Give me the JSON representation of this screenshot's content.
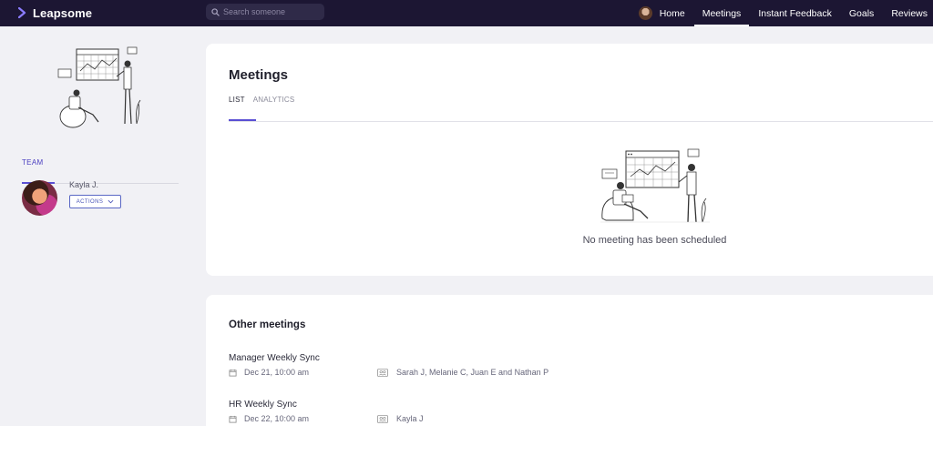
{
  "brand": {
    "name": "Leapsome",
    "accent": "#5a4fd3"
  },
  "search": {
    "placeholder": "Search someone"
  },
  "nav": {
    "items": [
      {
        "label": "Home"
      },
      {
        "label": "Meetings"
      },
      {
        "label": "Instant Feedback"
      },
      {
        "label": "Goals"
      },
      {
        "label": "Reviews"
      }
    ],
    "active": "Meetings"
  },
  "sidebar": {
    "tab": "TEAM",
    "members": [
      {
        "name": "Kayla J.",
        "actions_label": "ACTIONS"
      }
    ]
  },
  "meetings": {
    "title": "Meetings",
    "tabs": [
      "LIST",
      "ANALYTICS"
    ],
    "active_tab": "LIST",
    "empty_text": "No meeting has been scheduled"
  },
  "other_meetings": {
    "title": "Other meetings",
    "items": [
      {
        "name": "Manager Weekly Sync",
        "date": "Dec 21, 10:00 am",
        "participants": "Sarah J, Melanie C, Juan E and Nathan P"
      },
      {
        "name": "HR Weekly Sync",
        "date": "Dec 22, 10:00 am",
        "participants": "Kayla J"
      }
    ]
  },
  "icons": {
    "search": "search-icon",
    "calendar": "calendar-icon",
    "people": "people-icon",
    "chevron": "chevron-down-icon"
  }
}
